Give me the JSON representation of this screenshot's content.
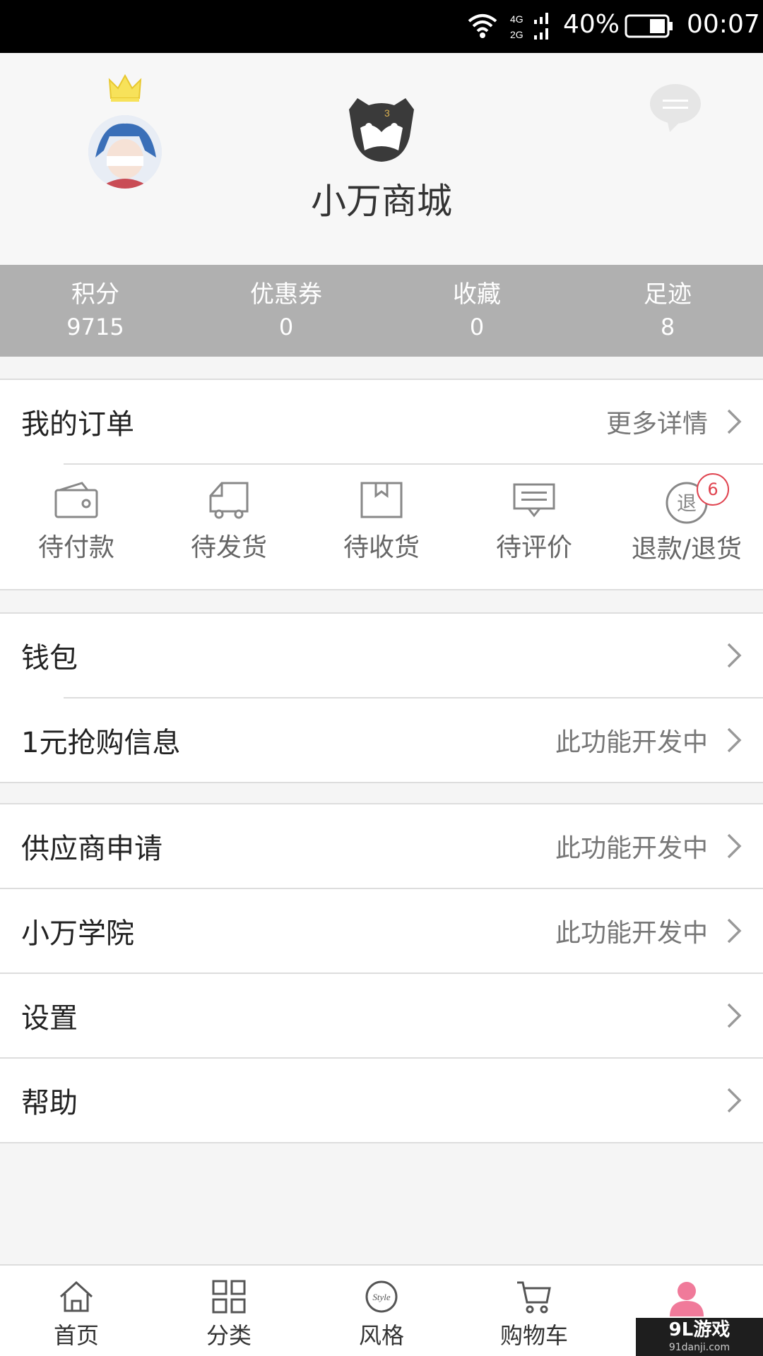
{
  "status_bar": {
    "battery": "40%",
    "time": "00:07"
  },
  "header": {
    "shop_name": "小万商城"
  },
  "stats": [
    {
      "label": "积分",
      "value": "9715"
    },
    {
      "label": "优惠券",
      "value": "0"
    },
    {
      "label": "收藏",
      "value": "0"
    },
    {
      "label": "足迹",
      "value": "8"
    }
  ],
  "orders": {
    "title": "我的订单",
    "more": "更多详情",
    "items": [
      {
        "label": "待付款",
        "icon": "wallet-icon"
      },
      {
        "label": "待发货",
        "icon": "truck-icon"
      },
      {
        "label": "待收货",
        "icon": "package-icon"
      },
      {
        "label": "待评价",
        "icon": "comment-icon"
      },
      {
        "label": "退款/退货",
        "icon": "refund-icon",
        "badge": "6",
        "glyph": "退"
      }
    ]
  },
  "menu": {
    "wallet": "钱包",
    "flash_sale": "1元抢购信息",
    "supplier": "供应商申请",
    "academy": "小万学院",
    "settings": "设置",
    "help": "帮助",
    "developing": "此功能开发中"
  },
  "tabbar": [
    {
      "label": "首页",
      "icon": "home-icon"
    },
    {
      "label": "分类",
      "icon": "grid-icon"
    },
    {
      "label": "风格",
      "icon": "style-icon",
      "glyph": "Style"
    },
    {
      "label": "购物车",
      "icon": "cart-icon"
    },
    {
      "label": "",
      "icon": "profile-icon"
    }
  ],
  "watermark": {
    "main": "9L游戏",
    "sub": "91danji.com"
  },
  "colors": {
    "accent": "#f07a9a",
    "badge": "#e0434f",
    "stats_bg": "#b0b0b0"
  }
}
